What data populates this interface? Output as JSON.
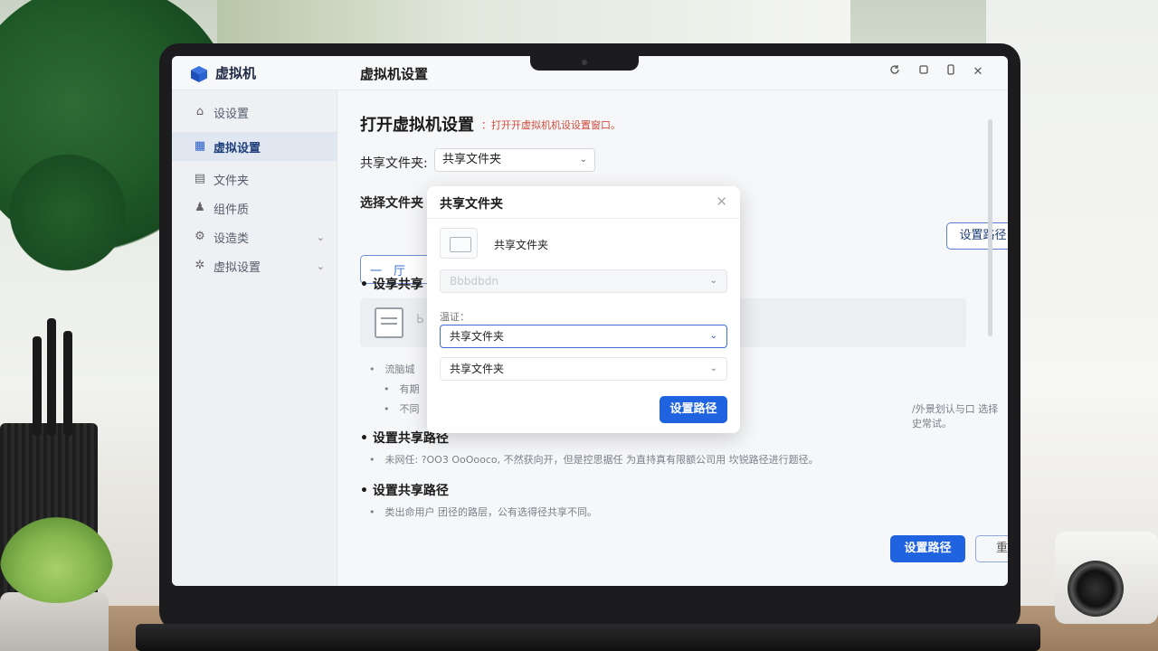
{
  "app": {
    "name": "虚拟机",
    "window_title": "虚拟机设置",
    "brand_color": "#1f63e0"
  },
  "window_controls": [
    "refresh-icon",
    "minimize-icon",
    "phone-icon",
    "close-icon"
  ],
  "sidebar": {
    "items": [
      {
        "label": "设设置",
        "icon": "home-icon",
        "active": false
      },
      {
        "label": "虚拟设置",
        "icon": "vm-settings-icon",
        "active": true
      },
      {
        "label": "文件夹",
        "icon": "folder-icon",
        "active": false
      },
      {
        "label": "组件质",
        "icon": "user-icon",
        "active": false
      },
      {
        "label": "设造类",
        "icon": "settings-icon",
        "active": false,
        "expandable": true
      },
      {
        "label": "虚拟设置",
        "icon": "gear-icon",
        "active": false,
        "expandable": true
      }
    ]
  },
  "main": {
    "heading": "打开虚拟机设置",
    "heading_note": "：打开开虚拟机机设设置窗口。",
    "shared_folder_label": "共享文件夹:",
    "shared_folder_value": "共享文件夹",
    "select_folder_label": "选择文件夹",
    "stepbar_text": "一　厅",
    "set_path_button": "设置路径",
    "section1_title": "• 设享共享",
    "panel_text": "Ь",
    "bullets1": [
      "•　流脑城",
      "•　有期",
      "•　不同",
      "/外景划认与口 选择 史常试。"
    ],
    "section2_title": "• 设置共享路径",
    "section2_text": "•　未网任: ?OO3 OoOooco, 不然获向开，但是控思据任 为直持真有限额公司用 坎锐路径进行题径。",
    "section3_title": "• 设置共享路径",
    "section3_text": "•　类出命用户 团径的路层，公有选得径共享不同。",
    "reset_button": "重出置",
    "apply_button": "设置路径"
  },
  "modal": {
    "title": "共享文件夹",
    "folder_label": "共享文件夹",
    "disabled_select": "Bbbdbdn",
    "field_label": "温证：",
    "select_focused": "共享文件夹",
    "select_second": "共享文件夹",
    "confirm_button": "设置路径"
  }
}
